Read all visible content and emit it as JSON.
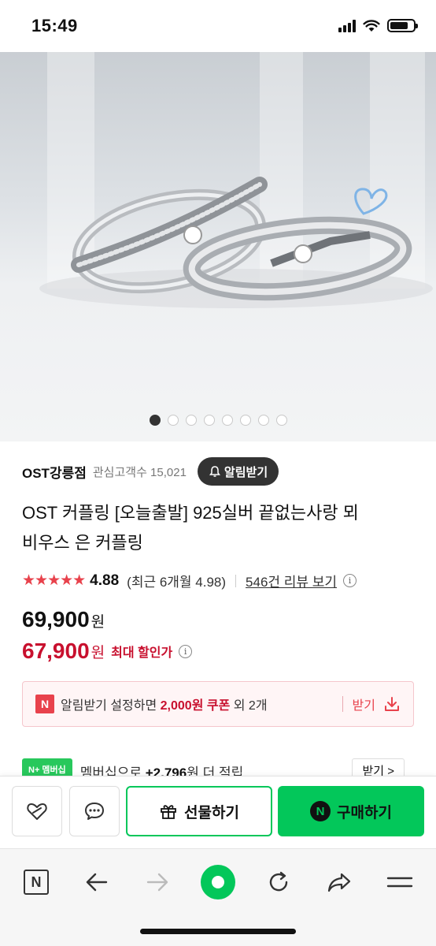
{
  "status_bar": {
    "time": "15:49"
  },
  "carousel": {
    "total_slides": 8,
    "active_index": 0
  },
  "seller": {
    "name": "OST강릉점",
    "followers_label": "관심고객수 15,021",
    "alert_button": "알림받기"
  },
  "product": {
    "title_line1": "OST 커플링 [오늘출발] 925실버 끝없는사랑 뫼",
    "title_line2": "비우스 은 커플링"
  },
  "rating": {
    "stars": "★★★★★",
    "score": "4.88",
    "recent": "(최근 6개월 4.98)",
    "reviews_link": "546건 리뷰 보기",
    "info": "i"
  },
  "price": {
    "original": "69,900",
    "original_unit": "원",
    "sale": "67,900",
    "sale_unit": "원",
    "sale_label": "최대 할인가",
    "info": "i"
  },
  "coupon": {
    "badge": "N",
    "msg_prefix": "알림받기 설정하면 ",
    "msg_amount": "2,000원 쿠폰",
    "msg_suffix": " 외 2개",
    "get_label": "받기"
  },
  "membership": {
    "badge": "N+ 멤버십",
    "text_prefix": "멤버십으로 ",
    "text_amount": "+2,796",
    "text_suffix": "원 더 적립",
    "more_label": "받기 >"
  },
  "actions": {
    "gift_label": "선물하기",
    "buy_label": "구매하기",
    "buy_badge": "N"
  },
  "browser_toolbar": {
    "home_badge": "N"
  },
  "colors": {
    "accent_green": "#03c75a",
    "sale_red": "#c8102e",
    "star_red": "#e8424c"
  }
}
